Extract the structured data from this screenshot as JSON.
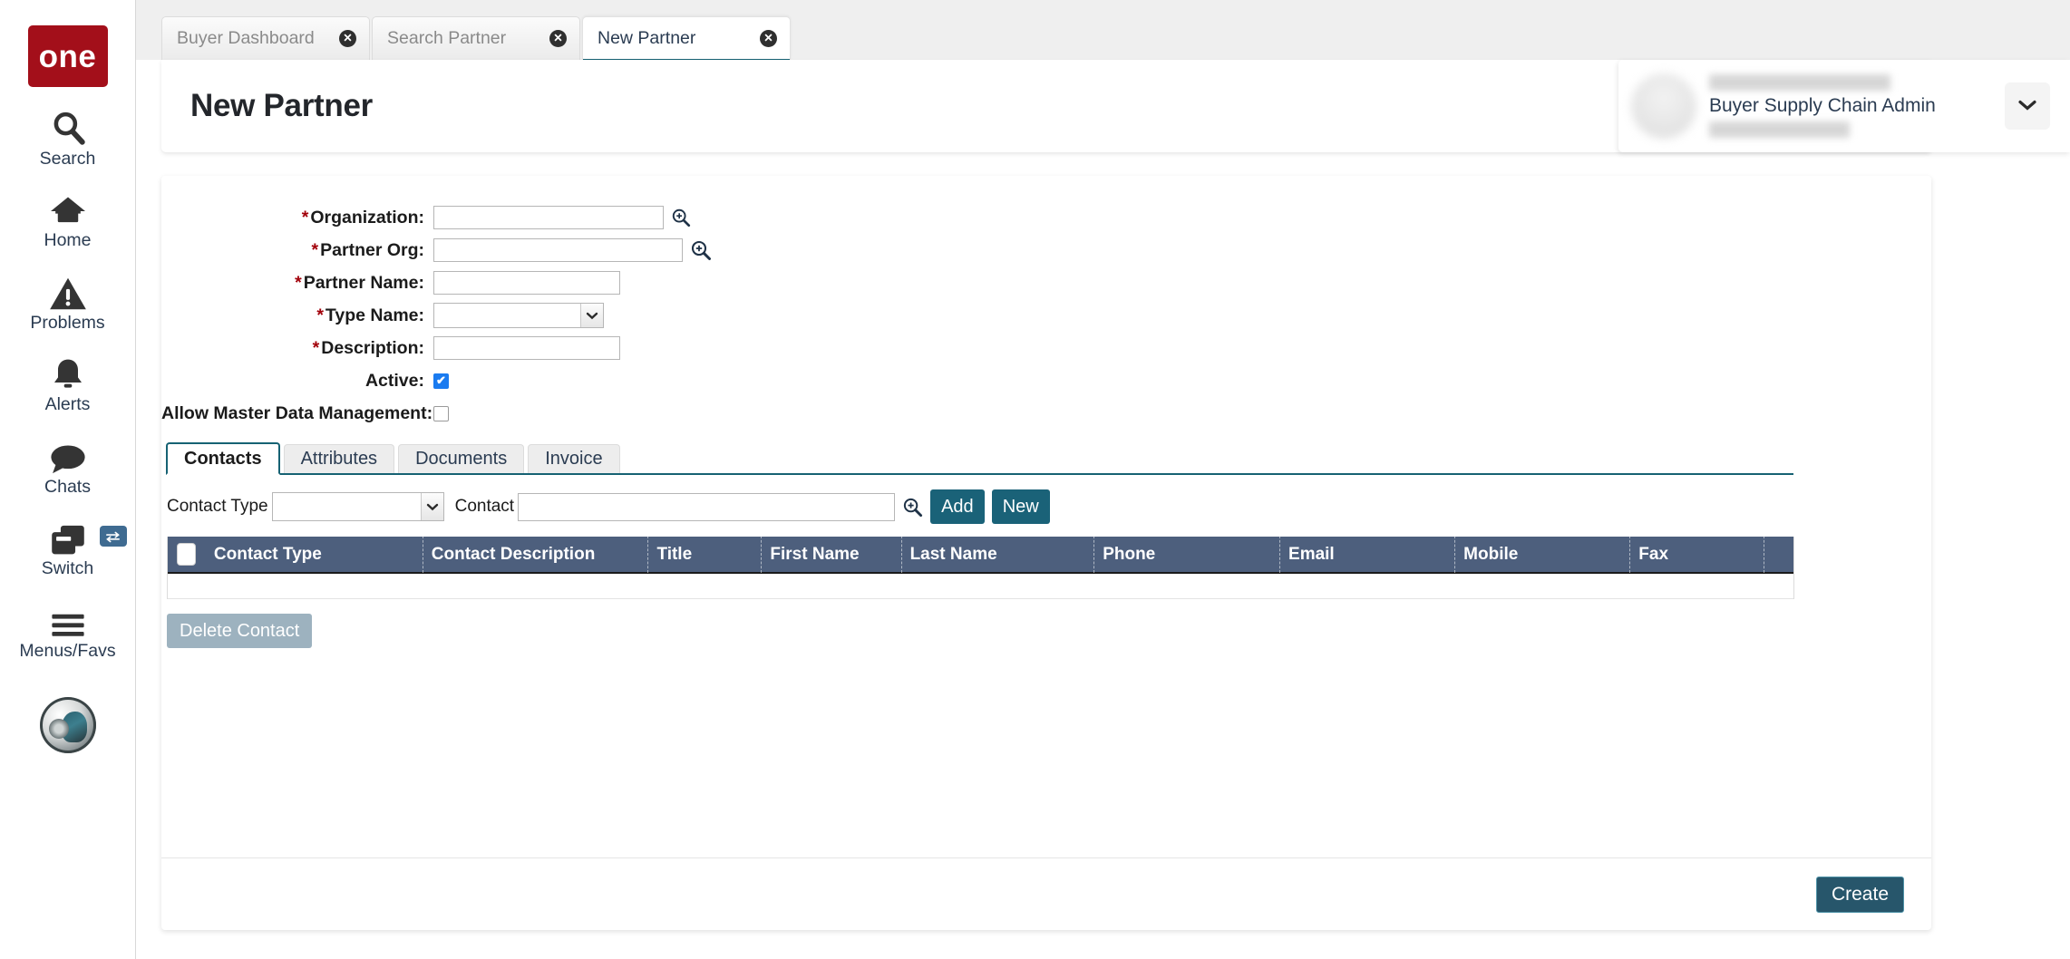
{
  "app": {
    "logo_text": "one",
    "brand_color": "#a30f1a",
    "accent_teal": "#0d5c70",
    "grid_header_color": "#4d5f7d"
  },
  "sidebar": {
    "items": [
      {
        "label": "Search",
        "icon": "search-icon"
      },
      {
        "label": "Home",
        "icon": "home-icon"
      },
      {
        "label": "Problems",
        "icon": "warning-triangle-icon"
      },
      {
        "label": "Alerts",
        "icon": "bell-icon"
      },
      {
        "label": "Chats",
        "icon": "chat-bubble-icon"
      },
      {
        "label": "Switch",
        "icon": "windows-switch-icon",
        "badge_icon": "swap-arrows-icon"
      },
      {
        "label": "Menus/Favs",
        "icon": "hamburger-icon"
      }
    ]
  },
  "tabstrip": {
    "tabs": [
      {
        "label": "Buyer Dashboard",
        "active": false,
        "close_icon": "close-circle-icon"
      },
      {
        "label": "Search Partner",
        "active": false,
        "close_icon": "close-circle-icon"
      },
      {
        "label": "New Partner",
        "active": true,
        "close_icon": "close-circle-icon"
      }
    ]
  },
  "header": {
    "title": "New Partner",
    "refresh_icon": "refresh-icon",
    "close_icon": "close-x-icon",
    "menu_icon": "list-menu-icon",
    "star_badge_icon": "star-icon"
  },
  "user": {
    "role": "Buyer Supply Chain Admin",
    "caret_icon": "chevron-down-icon",
    "avatar_icon": "avatar-icon"
  },
  "form": {
    "required_marker": "*",
    "fields": [
      {
        "label": "Organization:",
        "required": true,
        "value": "",
        "type": "lookup",
        "icon": "magnifier-plus-icon"
      },
      {
        "label": "Partner Org:",
        "required": true,
        "value": "",
        "type": "lookup",
        "icon": "magnifier-plus-icon"
      },
      {
        "label": "Partner Name:",
        "required": true,
        "value": "",
        "type": "text"
      },
      {
        "label": "Type Name:",
        "required": true,
        "value": "",
        "type": "select",
        "icon": "chevron-down-icon"
      },
      {
        "label": "Description:",
        "required": true,
        "value": "",
        "type": "text"
      },
      {
        "label": "Active:",
        "required": false,
        "value": "",
        "type": "checkbox",
        "checked": true
      },
      {
        "label": "Allow Master Data Management:",
        "required": false,
        "value": "",
        "type": "checkbox",
        "checked": false
      }
    ]
  },
  "inner_tabs": [
    {
      "label": "Contacts",
      "active": true
    },
    {
      "label": "Attributes",
      "active": false
    },
    {
      "label": "Documents",
      "active": false
    },
    {
      "label": "Invoice",
      "active": false
    }
  ],
  "contacts_panel": {
    "contact_type_label": "Contact Type",
    "contact_type_value": "",
    "contact_type_caret": "chevron-down-icon",
    "contact_label": "Contact",
    "contact_value": "",
    "contact_search_icon": "magnifier-plus-icon",
    "add_label": "Add",
    "new_label": "New",
    "delete_label": "Delete Contact",
    "grid": {
      "select_all_icon": "checkbox-column-icon",
      "columns": [
        "Contact Type",
        "Contact Description",
        "Title",
        "First Name",
        "Last Name",
        "Phone",
        "Email",
        "Mobile",
        "Fax"
      ],
      "rows": []
    }
  },
  "footer": {
    "create_label": "Create"
  }
}
